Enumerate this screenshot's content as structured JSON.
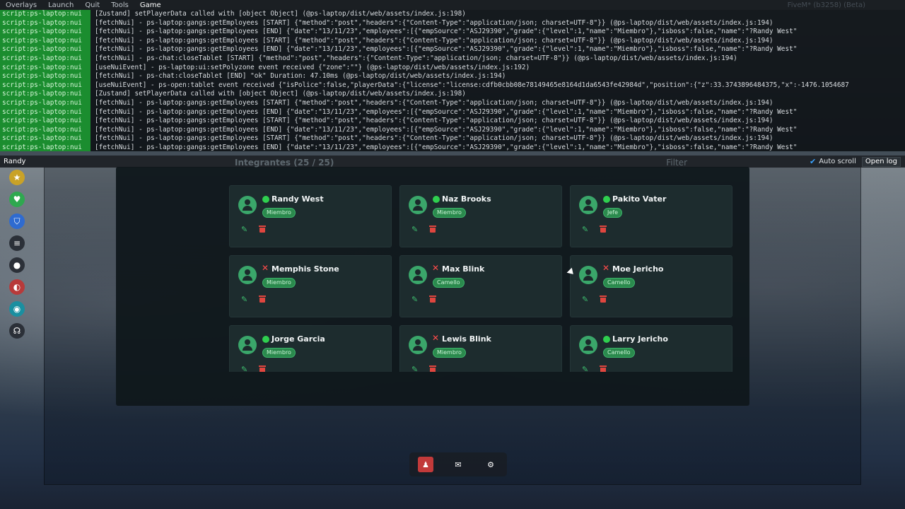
{
  "menubar": {
    "items": [
      "Overlays",
      "Launch",
      "Quit",
      "Tools",
      "Game"
    ],
    "active": "Game",
    "build": "FiveM* (b3258) (Beta)"
  },
  "console": {
    "lines": [
      {
        "src": "script:ps-laptop:nui",
        "msg": "[Zustand] setPlayerData called with [object Object] (@ps-laptop/dist/web/assets/index.js:198)"
      },
      {
        "src": "script:ps-laptop:nui",
        "msg": "[fetchNui] - ps-laptop:gangs:getEmployees [START] {\"method\":\"post\",\"headers\":{\"Content-Type\":\"application/json; charset=UTF-8\"}} (@ps-laptop/dist/web/assets/index.js:194)"
      },
      {
        "src": "script:ps-laptop:nui",
        "msg": "[fetchNui] - ps-laptop:gangs:getEmployees [END] {\"date\":\"13/11/23\",\"employees\":[{\"empSource\":\"ASJ29390\",\"grade\":{\"level\":1,\"name\":\"Miembro\"},\"isboss\":false,\"name\":\"?Randy West\""
      },
      {
        "src": "script:ps-laptop:nui",
        "msg": "[fetchNui] - ps-laptop:gangs:getEmployees [START] {\"method\":\"post\",\"headers\":{\"Content-Type\":\"application/json; charset=UTF-8\"}} (@ps-laptop/dist/web/assets/index.js:194)"
      },
      {
        "src": "script:ps-laptop:nui",
        "msg": "[fetchNui] - ps-laptop:gangs:getEmployees [END] {\"date\":\"13/11/23\",\"employees\":[{\"empSource\":\"ASJ29390\",\"grade\":{\"level\":1,\"name\":\"Miembro\"},\"isboss\":false,\"name\":\"?Randy West\""
      },
      {
        "src": "script:ps-laptop:nui",
        "msg": "[fetchNui] - ps-chat:closeTablet [START] {\"method\":\"post\",\"headers\":{\"Content-Type\":\"application/json; charset=UTF-8\"}} (@ps-laptop/dist/web/assets/index.js:194)"
      },
      {
        "src": "script:ps-laptop:nui",
        "msg": "[useNuiEvent] - ps-laptop:ui:setPolyzone event received {\"zone\":\"\"} (@ps-laptop/dist/web/assets/index.js:192)"
      },
      {
        "src": "script:ps-laptop:nui",
        "msg": "[fetchNui] - ps-chat:closeTablet [END] \"ok\" Duration: 47.10ms (@ps-laptop/dist/web/assets/index.js:194)"
      },
      {
        "src": "script:ps-laptop:nui",
        "msg": "[useNuiEvent] - ps-open:tablet event received {\"isPolice\":false,\"playerData\":{\"license\":\"license:cdfb0cbb08e78149465e8164d1da6543fe42984d\",\"position\":{\"z\":33.3743896484375,\"x\":-1476.1054687"
      },
      {
        "src": "script:ps-laptop:nui",
        "msg": "[Zustand] setPlayerData called with [object Object] (@ps-laptop/dist/web/assets/index.js:198)"
      },
      {
        "src": "script:ps-laptop:nui",
        "msg": "[fetchNui] - ps-laptop:gangs:getEmployees [START] {\"method\":\"post\",\"headers\":{\"Content-Type\":\"application/json; charset=UTF-8\"}} (@ps-laptop/dist/web/assets/index.js:194)"
      },
      {
        "src": "script:ps-laptop:nui",
        "msg": "[fetchNui] - ps-laptop:gangs:getEmployees [END] {\"date\":\"13/11/23\",\"employees\":[{\"empSource\":\"ASJ29390\",\"grade\":{\"level\":1,\"name\":\"Miembro\"},\"isboss\":false,\"name\":\"?Randy West\""
      },
      {
        "src": "script:ps-laptop:nui",
        "msg": "[fetchNui] - ps-laptop:gangs:getEmployees [START] {\"method\":\"post\",\"headers\":{\"Content-Type\":\"application/json; charset=UTF-8\"}} (@ps-laptop/dist/web/assets/index.js:194)"
      },
      {
        "src": "script:ps-laptop:nui",
        "msg": "[fetchNui] - ps-laptop:gangs:getEmployees [END] {\"date\":\"13/11/23\",\"employees\":[{\"empSource\":\"ASJ29390\",\"grade\":{\"level\":1,\"name\":\"Miembro\"},\"isboss\":false,\"name\":\"?Randy West\""
      },
      {
        "src": "script:ps-laptop:nui",
        "msg": "[fetchNui] - ps-laptop:gangs:getEmployees [START] {\"method\":\"post\",\"headers\":{\"Content-Type\":\"application/json; charset=UTF-8\"}} (@ps-laptop/dist/web/assets/index.js:194)"
      },
      {
        "src": "script:ps-laptop:nui",
        "msg": "[fetchNui] - ps-laptop:gangs:getEmployees [END] {\"date\":\"13/11/23\",\"employees\":[{\"empSource\":\"ASJ29390\",\"grade\":{\"level\":1,\"name\":\"Miembro\"},\"isboss\":false,\"name\":\"?Randy West\""
      }
    ]
  },
  "console_bar": {
    "input_value": "Randy",
    "auto_scroll_label": "Auto scroll",
    "open_log_label": "Open log"
  },
  "app": {
    "header_title": "Integrantes (25 / 25)",
    "filter_label": "Filter",
    "employees": [
      {
        "name": "Randy West",
        "rank": "Miembro",
        "online": true
      },
      {
        "name": "Naz Brooks",
        "rank": "Miembro",
        "online": true
      },
      {
        "name": "Pakito Vater",
        "rank": "Jefe",
        "online": true
      },
      {
        "name": "Memphis Stone",
        "rank": "Miembro",
        "online": false
      },
      {
        "name": "Max Blink",
        "rank": "Camello",
        "online": false
      },
      {
        "name": "Moe Jericho",
        "rank": "Camello",
        "online": false
      },
      {
        "name": "Jorge Garcia",
        "rank": "Miembro",
        "online": true
      },
      {
        "name": "Lewis Blink",
        "rank": "Miembro",
        "online": false
      },
      {
        "name": "Larry Jericho",
        "rank": "Camello",
        "online": true
      }
    ]
  },
  "sidebar": {
    "icons": [
      {
        "name": "badge-icon",
        "color": "#c9a227"
      },
      {
        "name": "heart-icon",
        "color": "#2fa84f"
      },
      {
        "name": "shield-icon",
        "color": "#2f6bd0"
      },
      {
        "name": "food-icon",
        "color": "#2b3038"
      },
      {
        "name": "water-icon",
        "color": "#2b3038"
      },
      {
        "name": "stress-icon",
        "color": "#b83a3a"
      },
      {
        "name": "eye-icon",
        "color": "#1a8fa0"
      },
      {
        "name": "voice-icon",
        "color": "#2b3038"
      }
    ]
  },
  "dock": {
    "items": [
      {
        "name": "gang-app-icon",
        "glyph": "♟",
        "active": true
      },
      {
        "name": "mail-app-icon",
        "glyph": "✉",
        "active": false
      },
      {
        "name": "settings-app-icon",
        "glyph": "⚙",
        "active": false
      }
    ]
  }
}
